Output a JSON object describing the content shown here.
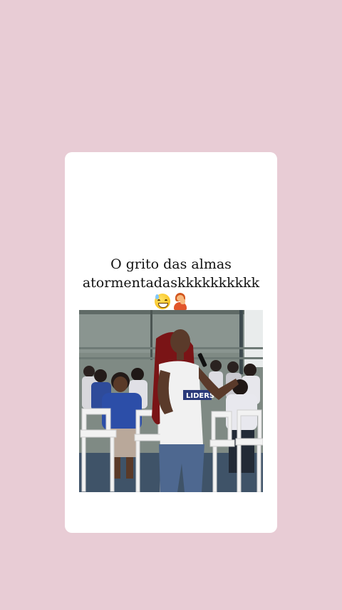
{
  "post": {
    "caption_line1": "O grito das almas",
    "caption_line2": "atormentadaskkkkkkkkkk",
    "emojis": [
      "grinning-face-with-sweat",
      "person-facepalming"
    ],
    "shirt_text": "LIDERS"
  },
  "colors": {
    "background": "#e8ccd5",
    "card": "#ffffff",
    "text": "#111111"
  }
}
